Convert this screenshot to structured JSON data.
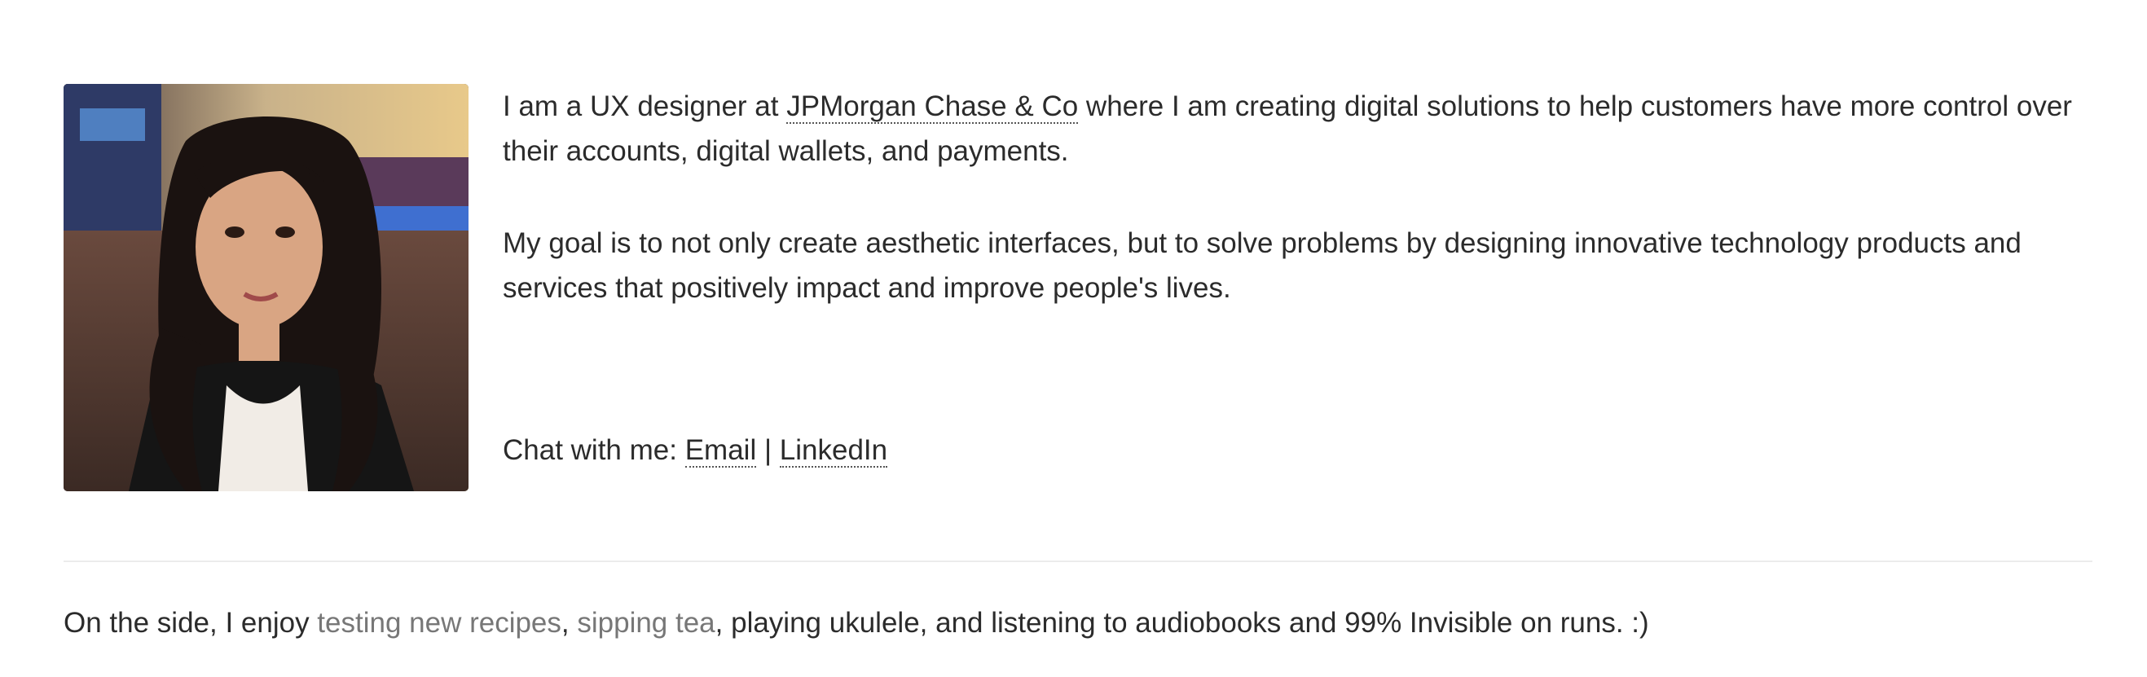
{
  "bio": {
    "intro_before": "I am a UX designer at ",
    "employer_link": "JPMorgan Chase & Co",
    "intro_after": " where I am creating digital solutions to help customers have more control over their accounts, digital wallets, and payments.",
    "goal": "My goal is to not only create aesthetic interfaces, but to solve problems by designing innovative technology products and services that positively impact and improve people's lives.",
    "contact_prefix": "Chat with me: ",
    "email_link": "Email",
    "separator": " | ",
    "linkedin_link": "LinkedIn"
  },
  "side": {
    "prefix": "On the side, I enjoy ",
    "recipes_link": "testing new recipes",
    "comma": ", ",
    "tea_link": "sipping tea",
    "suffix": ", playing ukulele, and listening to audiobooks and 99% Invisible on runs. :)"
  },
  "colors": {
    "text": "#2b2b2b",
    "muted_link": "#777777",
    "divider": "#ececec"
  }
}
